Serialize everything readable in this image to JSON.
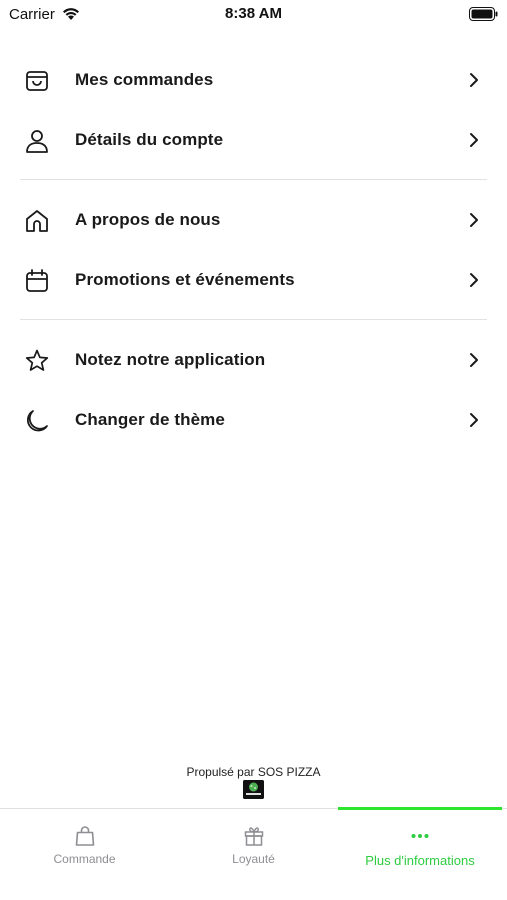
{
  "status_bar": {
    "carrier": "Carrier",
    "time": "8:38 AM"
  },
  "menu": {
    "groups": [
      [
        {
          "label": "Mes commandes",
          "icon": "shopping-bag-icon"
        },
        {
          "label": "Détails du compte",
          "icon": "user-icon"
        }
      ],
      [
        {
          "label": "A propos de nous",
          "icon": "home-icon"
        },
        {
          "label": "Promotions et événements",
          "icon": "calendar-icon"
        }
      ],
      [
        {
          "label": "Notez notre application",
          "icon": "star-icon"
        },
        {
          "label": "Changer de thème",
          "icon": "moon-icon"
        }
      ]
    ]
  },
  "footer": {
    "credit": "Propulsé par SOS PIZZA"
  },
  "tabbar": {
    "tabs": [
      {
        "label": "Commande",
        "icon": "shopping-bag-icon",
        "active": false
      },
      {
        "label": "Loyauté",
        "icon": "gift-icon",
        "active": false
      },
      {
        "label": "Plus d'informations",
        "icon": "more-dots-icon",
        "active": true
      }
    ]
  },
  "colors": {
    "accent": "#2ecc40",
    "text": "#1a1a1a",
    "inactive_tab": "#8e8e93",
    "divider": "#e2e2e2"
  }
}
